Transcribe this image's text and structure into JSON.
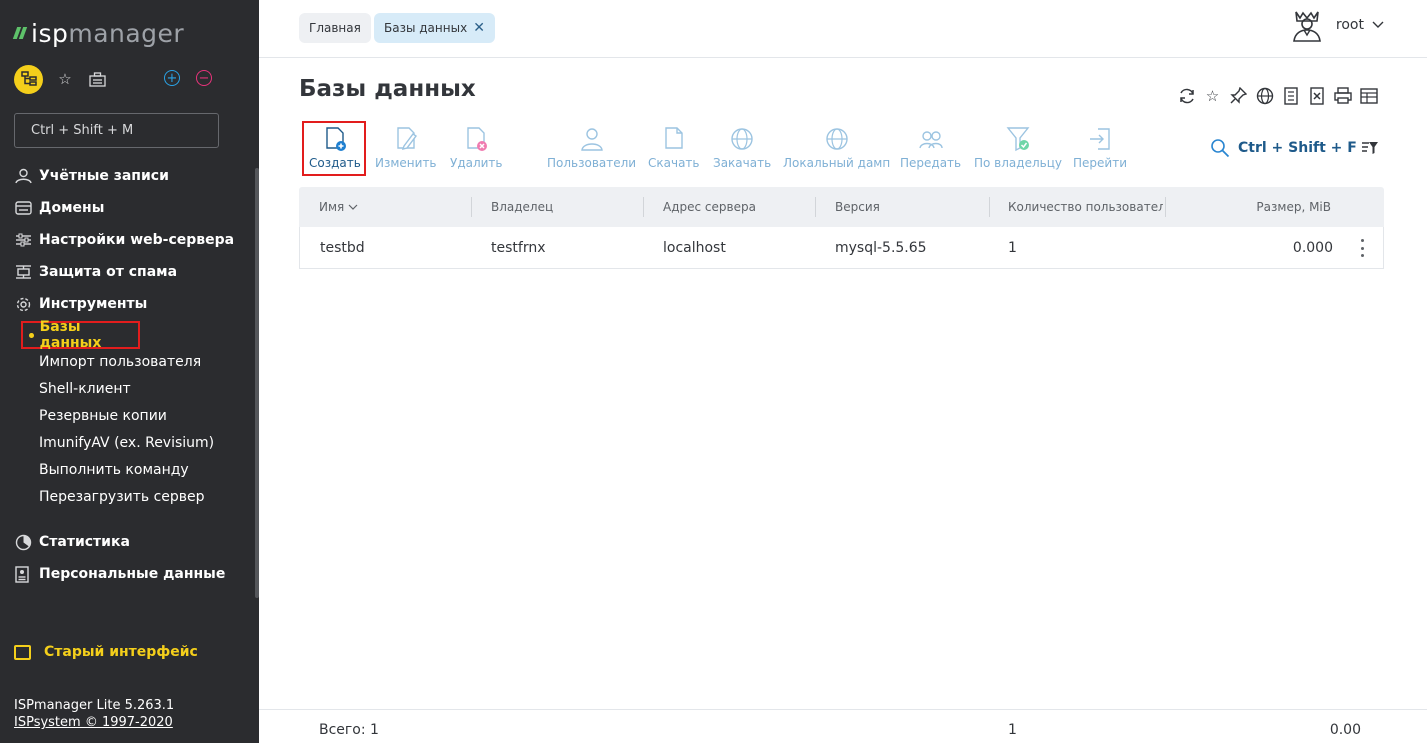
{
  "sidebar": {
    "logo": {
      "prefix": "isp",
      "suffix": "manager"
    },
    "hotkey_placeholder": "Ctrl + Shift + M",
    "nav": [
      {
        "label": "Учётные записи",
        "icon": "user-accounts-icon"
      },
      {
        "label": "Домены",
        "icon": "domains-icon"
      },
      {
        "label": "Настройки web-сервера",
        "icon": "sliders-icon"
      },
      {
        "label": "Защита от спама",
        "icon": "spam-shield-icon"
      },
      {
        "label": "Инструменты",
        "icon": "gear-icon"
      },
      {
        "label": "Статистика",
        "icon": "pie-chart-icon"
      },
      {
        "label": "Персональные данные",
        "icon": "personal-data-icon"
      }
    ],
    "tools_items": [
      {
        "label": "Базы данных",
        "active": true
      },
      {
        "label": "Импорт пользователя"
      },
      {
        "label": "Shell-клиент"
      },
      {
        "label": "Резервные копии"
      },
      {
        "label": "ImunifyAV (ex. Revisium)"
      },
      {
        "label": "Выполнить команду"
      },
      {
        "label": "Перезагрузить сервер"
      }
    ],
    "old_interface": "Старый интерфейс",
    "version": "ISPmanager Lite 5.263.1",
    "copyright": "ISPsystem © 1997-2020"
  },
  "topbar": {
    "tabs": [
      {
        "label": "Главная"
      },
      {
        "label": "Базы данных",
        "closable": true
      }
    ],
    "user": "root"
  },
  "main": {
    "title": "Базы данных",
    "toolbar": [
      {
        "label": "Создать",
        "icon": "create-db-icon",
        "enabled": true
      },
      {
        "label": "Изменить",
        "icon": "edit-icon"
      },
      {
        "label": "Удалить",
        "icon": "delete-icon"
      },
      {
        "label": "Пользователи",
        "icon": "users-icon"
      },
      {
        "label": "Скачать",
        "icon": "download-icon"
      },
      {
        "label": "Закачать",
        "icon": "upload-icon"
      },
      {
        "label": "Локальный дамп",
        "icon": "local-dump-icon"
      },
      {
        "label": "Передать",
        "icon": "transfer-icon"
      },
      {
        "label": "По владельцу",
        "icon": "filter-owner-icon"
      },
      {
        "label": "Перейти",
        "icon": "go-to-icon"
      }
    ],
    "search_hotkey": "Ctrl + Shift + F",
    "table": {
      "columns": [
        "Имя",
        "Владелец",
        "Адрес сервера",
        "Версия",
        "Количество пользователей",
        "Размер, MiB"
      ],
      "rows": [
        {
          "name": "testbd",
          "owner": "testfrnx",
          "server": "localhost",
          "version": "mysql-5.5.65",
          "users": "1",
          "size": "0.000"
        }
      ]
    },
    "footer": {
      "total_label": "Всего: 1",
      "users_total": "1",
      "size_total": "0.00"
    }
  },
  "colors": {
    "accent": "#1e5a8a",
    "sidebar_bg": "#2b2c2f",
    "highlight": "#f4cf1b",
    "logo_green": "#5ec26a",
    "red_marker": "#e21d1d"
  }
}
